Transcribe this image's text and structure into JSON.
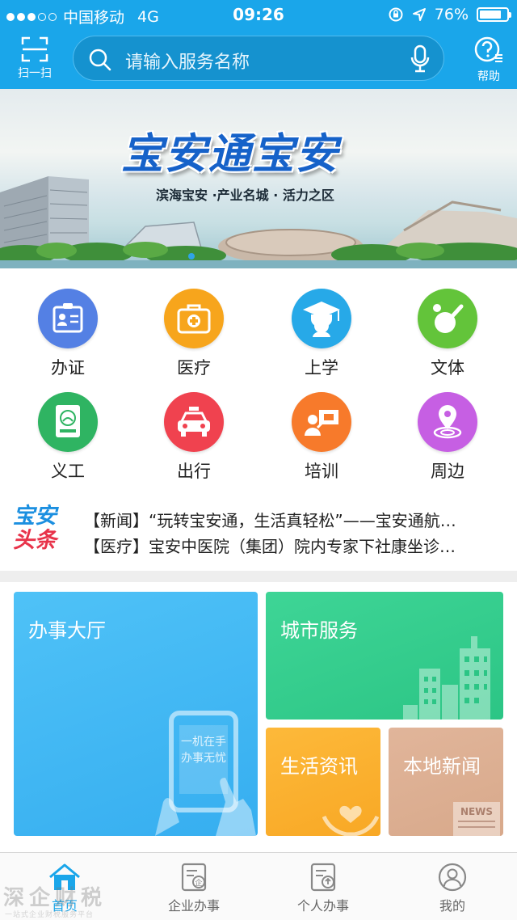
{
  "status_bar": {
    "carrier": "中国移动",
    "network": "4G",
    "time": "09:26",
    "battery": "76%",
    "battery_level": 0.76
  },
  "header": {
    "scan_label": "扫一扫",
    "search_placeholder": "请输入服务名称",
    "help_label": "帮助",
    "accent_color": "#1aa6ea"
  },
  "banner": {
    "title": "宝安通宝安",
    "subtitle": "滨海宝安 ·产业名城 · 活力之区"
  },
  "services": [
    {
      "label": "办证",
      "icon": "id-card-icon",
      "color": "#4f7fe6"
    },
    {
      "label": "医疗",
      "icon": "medical-kit-icon",
      "color": "#f7a51c"
    },
    {
      "label": "上学",
      "icon": "graduation-cap-icon",
      "color": "#27a9e8"
    },
    {
      "label": "文体",
      "icon": "ping-pong-icon",
      "color": "#63c43a"
    },
    {
      "label": "义工",
      "icon": "volunteer-badge-icon",
      "color": "#2fb462"
    },
    {
      "label": "出行",
      "icon": "taxi-icon",
      "color": "#f0424f"
    },
    {
      "label": "培训",
      "icon": "training-icon",
      "color": "#f77a2b"
    },
    {
      "label": "周边",
      "icon": "location-pin-icon",
      "color": "#c65fe3"
    }
  ],
  "headlines": {
    "logo_line1": "宝安",
    "logo_line2": "头条",
    "items": [
      "【新闻】“玩转宝安通，生活真轻松”——宝安通航…",
      "【医疗】宝安中医院（集团）院内专家下社康坐诊…"
    ]
  },
  "tiles": {
    "hall": "办事大厅",
    "hall_phone_text1": "一机在手",
    "hall_phone_text2": "办事无忧",
    "city": "城市服务",
    "life": "生活资讯",
    "local_news": "本地新闻",
    "news_tag": "NEWS"
  },
  "tabbar": {
    "items": [
      {
        "label": "首页",
        "icon": "home-icon",
        "active": true
      },
      {
        "label": "企业办事",
        "icon": "enterprise-doc-icon",
        "active": false
      },
      {
        "label": "个人办事",
        "icon": "personal-doc-icon",
        "active": false
      },
      {
        "label": "我的",
        "icon": "user-icon",
        "active": false
      }
    ]
  },
  "watermark": {
    "text": "深企财税",
    "sub": "一站式企业财税服务平台"
  }
}
